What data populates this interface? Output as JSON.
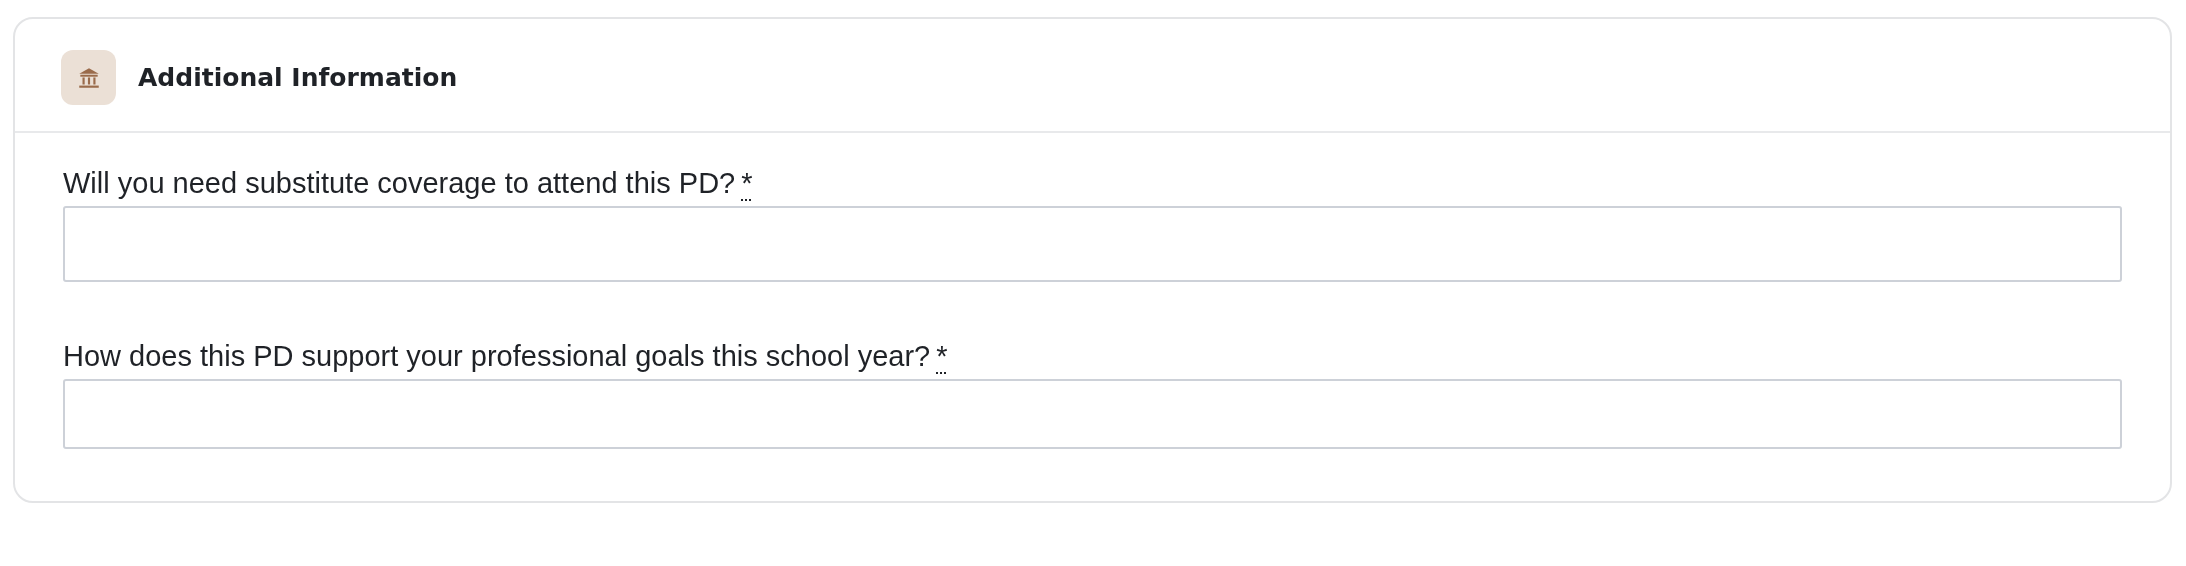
{
  "section": {
    "title": "Additional Information"
  },
  "questions": [
    {
      "label": "Will you need substitute coverage to attend this PD?",
      "required_mark": "*"
    },
    {
      "label": "How does this PD support your professional goals this school year?",
      "required_mark": "*"
    }
  ]
}
